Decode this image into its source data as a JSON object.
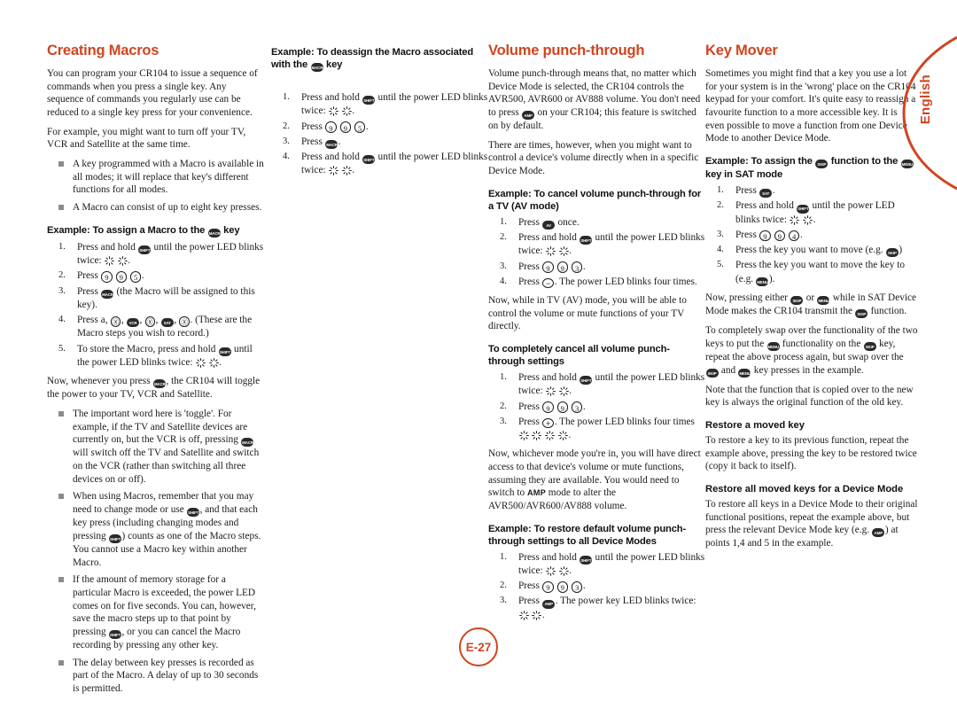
{
  "page": {
    "number": "E-27",
    "language_tab": "English"
  },
  "columns": [
    {
      "id": "creating-macros",
      "title": "Creating Macros",
      "blocks": [
        {
          "type": "p",
          "text": "You can program your CR104 to issue a sequence of commands when you press a single key. Any sequence of commands you regularly use can be reduced to a single key press for your convenience."
        },
        {
          "type": "p",
          "text": "For example, you might want to turn off your TV, VCR and Satellite at the same time."
        },
        {
          "type": "ul",
          "items": [
            "A key programmed with a Macro is available in all modes; it will replace that key's different functions for all modes.",
            "A Macro can consist of up to eight key presses."
          ]
        },
        {
          "type": "h2",
          "text": "Example: To assign a Macro to the",
          "key_after": "MACRO",
          "text_after": "key"
        },
        {
          "type": "ol",
          "items": [
            "Press and hold [SHIFT] until the power LED blinks twice: [BLINK] [BLINK].",
            "Press [9] [9] [5].",
            "Press [MACRO] (the Macro will be assigned to this key).",
            "Press a, [POWER], [VCR], [POWER], [SAT], [POWER]. (These are the Macro steps you wish to record.)",
            "To store the Macro, press and hold [SHIFT] until the power LED blinks twice: [BLINK] [BLINK]."
          ]
        },
        {
          "type": "p",
          "text": "Now, whenever you press [MACRO], the CR104 will toggle the power to your TV, VCR and Satellite."
        },
        {
          "type": "ul",
          "items": [
            "The important word here is 'toggle'. For example, if the TV and Satellite devices are currently on, but the VCR is off, pressing [MACRO] will switch off the TV and Satellite and switch on the VCR (rather than switching all three devices on or off).",
            "When using Macros, remember that you may need to change mode or use [SHIFT], and that each key press (including changing modes and pressing [SHIFT]) counts as one of the Macro steps. You cannot use a Macro key within another Macro.",
            "If the amount of memory storage for a particular Macro is exceeded, the power LED comes on for five seconds. You can, however, save the macro steps up to that point by pressing [SHIFT], or you can cancel the Macro recording by pressing any other key.",
            "The delay between key presses is recorded as part of the Macro. A delay of up to 30 seconds is permitted."
          ]
        }
      ]
    },
    {
      "id": "deassign-macro",
      "title": "",
      "heading": "Example: To deassign the Macro associated with the",
      "heading_key": "MACRO",
      "heading_after": "key",
      "steps": [
        "Press and hold [SHIFT] until the power LED blinks twice: [BLINK] [BLINK].",
        "Press [9] [9] [5].",
        "Press [MACRO].",
        "Press and hold [SHIFT] until the power LED blinks twice: [BLINK] [BLINK]."
      ]
    },
    {
      "id": "volume-punch-through",
      "title": "Volume punch-through",
      "intro1": "Volume punch-through means that, no matter which Device Mode is selected, the CR104 controls the AVR500, AVR600 or AV888 volume. You don't need to press [AMP] on your CR104; this feature is switched on by default.",
      "intro2": "There are times, however, when you might want to control a device's volume directly when in a specific Device Mode.",
      "sub1": "Example: To cancel volume punch-through for a TV (AV mode)",
      "sub1_steps": [
        "Press [AV] once.",
        "Press and hold [SHIFT] until the power LED blinks twice: [BLINK] [BLINK].",
        "Press [9] [9] [3].",
        "Press [MINUS]. The power LED blinks four times."
      ],
      "sub1_note": "Now, while in TV (AV) mode, you will be able to control the volume or mute functions of your TV directly.",
      "sub2": "To completely cancel all volume punch-through settings",
      "sub2_steps": [
        "Press and hold [SHIFT] until the power LED blinks twice: [BLINK] [BLINK].",
        "Press [9] [9] [3].",
        "Press [PLUS]. The power LED blinks four times [BLINK] [BLINK] [BLINK] [BLINK]."
      ],
      "sub2_note_pre": "Now, whichever mode you're in, you will have direct access to that device's volume or mute functions, assuming they are available. You would need to switch to",
      "sub2_note_smallcap": "AMP",
      "sub2_note_post": "mode to alter the AVR500/AVR600/AV888 volume.",
      "sub3": "Example: To restore default volume punch-through settings to all Device Modes",
      "sub3_steps": [
        "Press and hold [SHIFT] until the power LED blinks twice: [BLINK] [BLINK].",
        "Press [9] [9] [3].",
        "Press [AMP]. The power key LED blinks twice: [BLINK] [BLINK]."
      ]
    },
    {
      "id": "key-mover",
      "title": "Key Mover",
      "intro": "Sometimes you might find that a key you use a lot for your system is in the 'wrong' place on the CR104 keypad for your comfort. It's quite easy to reassign a favourite function to a more accessible key. It is even possible to move a function from one Device Mode to another Device Mode.",
      "sub1_a": "Example: To assign the",
      "sub1_key1": "SKIP",
      "sub1_b": "function to the",
      "sub1_key2": "MENU",
      "sub1_c": "key in SAT mode",
      "sub1_steps": [
        "Press [SAT].",
        "Press and hold [SHIFT] until the power LED blinks twice: [BLINK] [BLINK].",
        "Press [9] [9] [4].",
        "Press the key you want to move (e.g. [SKIP])",
        "Press the key you want to move the key to (e.g. [MENU])."
      ],
      "note1": "Now, pressing either [SKIP] or [MENU] while in SAT Device Mode makes the CR104 transmit the [SKIP] function.",
      "note2": "To completely swap over the functionality of the two keys to put the [MENU] functionality on the [SKIP] key, repeat the above process again, but swap over the [SKIP] and [MENU] key presses in the example.",
      "note3": "Note that the function that is copied over to the new key is always the original function of the old key.",
      "sub2": "Restore a moved key",
      "note4": "To restore a key to its previous function, repeat the example above, pressing the key to be restored twice (copy it back to itself).",
      "sub3": "Restore all moved keys for a Device Mode",
      "note5": "To restore all keys in a Device Mode to their original functional positions, repeat the example above, but press the relevant Device Mode key (e.g. [AMP]) at points 1,4 and 5 in the example."
    }
  ],
  "keys": {
    "SHIFT": "SHIFT",
    "MACRO": "MACRO",
    "POWER": "PWR",
    "VCR": "VCR",
    "SAT": "SAT",
    "AMP": "AMP",
    "AV": "AV",
    "SKIP": "SKIP",
    "MENU": "MENU",
    "MINUS": "−",
    "PLUS": "+",
    "9": "9",
    "5": "5",
    "3": "3",
    "4": "4"
  },
  "colors": {
    "accent": "#cf4520",
    "text": "#1a1a1a",
    "bullet": "#8b8b8b"
  },
  "icons": {
    "blink": "led-blink-starburst-icon",
    "page_badge": "page-number-circle-icon",
    "lang_arc": "language-tab-arc-icon"
  }
}
